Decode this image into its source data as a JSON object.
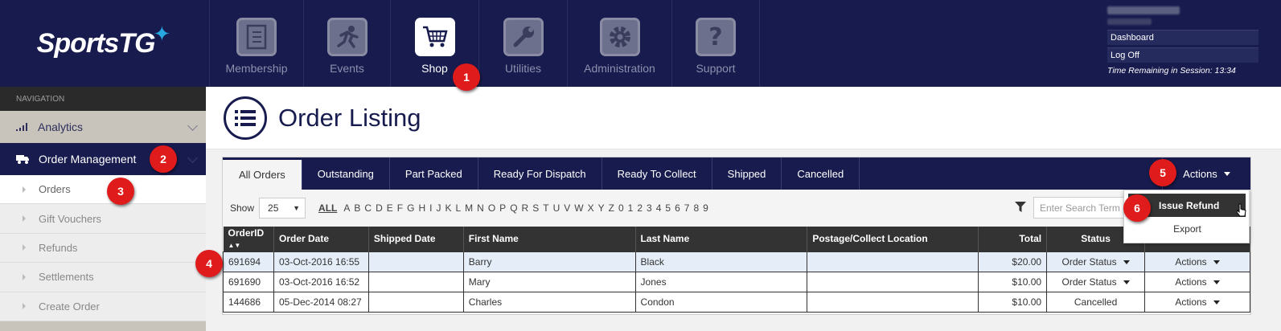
{
  "header": {
    "logo": "SportsTG",
    "nav": [
      {
        "label": "Membership",
        "icon": "clipboard-icon"
      },
      {
        "label": "Events",
        "icon": "runner-icon"
      },
      {
        "label": "Shop",
        "icon": "cart-icon",
        "active": true
      },
      {
        "label": "Utilities",
        "icon": "wrench-icon"
      },
      {
        "label": "Administration",
        "icon": "gear-icon"
      },
      {
        "label": "Support",
        "icon": "question-icon"
      }
    ],
    "user_links": [
      "Dashboard",
      "Log Off"
    ],
    "session": "Time Remaining in Session: 13:34"
  },
  "sidebar": {
    "heading": "NAVIGATION",
    "analytics": "Analytics",
    "order_management": "Order Management",
    "items": [
      "Orders",
      "Gift Vouchers",
      "Refunds",
      "Settlements",
      "Create Order"
    ]
  },
  "page": {
    "title": "Order Listing"
  },
  "tabs": [
    "All Orders",
    "Outstanding",
    "Part Packed",
    "Ready For Dispatch",
    "Ready To Collect",
    "Shipped",
    "Cancelled"
  ],
  "actions_label": "Actions",
  "toolbar": {
    "show_label": "Show",
    "show_value": "25",
    "alpha": [
      "ALL",
      "A",
      "B",
      "C",
      "D",
      "E",
      "F",
      "G",
      "H",
      "I",
      "J",
      "K",
      "L",
      "M",
      "N",
      "O",
      "P",
      "Q",
      "R",
      "S",
      "T",
      "U",
      "V",
      "W",
      "X",
      "Y",
      "Z",
      "0",
      "1",
      "2",
      "3",
      "4",
      "5",
      "6",
      "7",
      "8",
      "9"
    ],
    "search_placeholder": "Enter Search Term"
  },
  "table": {
    "columns": [
      "OrderID",
      "Order Date",
      "Shipped Date",
      "First Name",
      "Last Name",
      "Postage/Collect Location",
      "Total",
      "Status",
      "Actions"
    ],
    "rows": [
      {
        "id": "691694",
        "date": "03-Oct-2016 16:55",
        "shipped": "",
        "first": "Barry",
        "last": "Black",
        "location": "",
        "total": "$20.00",
        "status": "Order Status",
        "actions": "Actions"
      },
      {
        "id": "691690",
        "date": "03-Oct-2016 16:52",
        "shipped": "",
        "first": "Mary",
        "last": "Jones",
        "location": "",
        "total": "$10.00",
        "status": "Order Status",
        "actions": "Actions"
      },
      {
        "id": "144686",
        "date": "05-Dec-2014 08:27",
        "shipped": "",
        "first": "Charles",
        "last": "Condon",
        "location": "",
        "total": "$10.00",
        "status": "Cancelled",
        "actions": "Actions"
      }
    ]
  },
  "dropdown": {
    "issue_refund": "Issue Refund",
    "export": "Export"
  },
  "badges": [
    "1",
    "2",
    "3",
    "4",
    "5",
    "6"
  ],
  "colors": {
    "navy": "#171b4e",
    "badge_red": "#e01b1b",
    "accent_blue": "#27a8e0"
  }
}
